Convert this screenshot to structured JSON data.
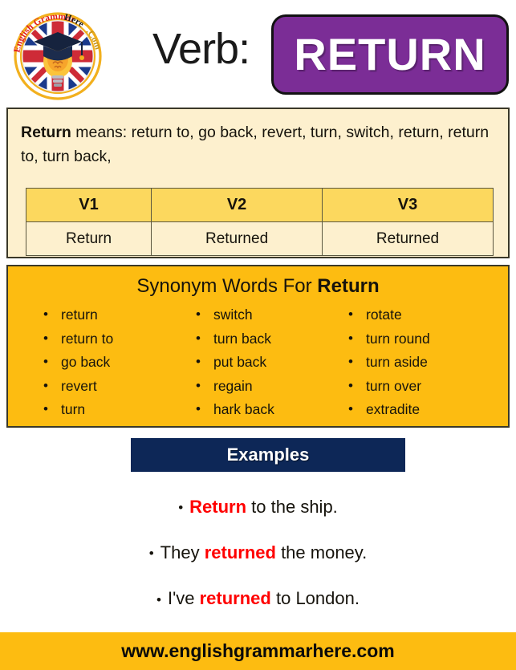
{
  "logo": {
    "name": "english-grammar-here-logo",
    "text_top": "English Grammar",
    "text_bottom": "Here.Com",
    "alt": "English Grammar Here.Com logo with UK flag, graduation cap and lightbulb"
  },
  "header": {
    "verb_label": "Verb:",
    "word": "RETURN",
    "word_box_color": "#7B2D96"
  },
  "meaning": {
    "subject": "Return",
    "prefix": " means: ",
    "definition": "return to, go back, revert, turn, switch, return, return to, turn back,"
  },
  "verb_table": {
    "headers": [
      "V1",
      "V2",
      "V3"
    ],
    "row": [
      "Return",
      "Returned",
      "Returned"
    ]
  },
  "synonyms": {
    "title_prefix": "Synonym Words For ",
    "title_word": "Return",
    "columns": [
      [
        "return",
        "return to",
        "go back",
        "revert",
        "turn"
      ],
      [
        "switch",
        "turn back",
        "put back",
        "regain",
        "hark back"
      ],
      [
        "rotate",
        "turn round",
        "turn aside",
        "turn over",
        "extradite"
      ]
    ]
  },
  "examples": {
    "heading": "Examples",
    "heading_color": "#0D2757",
    "highlight_color": "#FF0000",
    "items": [
      {
        "pre": "",
        "hl": "Return",
        "post": " to the ship."
      },
      {
        "pre": "They ",
        "hl": "returned",
        "post": " the money."
      },
      {
        "pre": "I've ",
        "hl": "returned",
        "post": " to London."
      }
    ]
  },
  "footer": {
    "url": "www.englishgrammarhere.com",
    "background": "#FDBC11"
  }
}
